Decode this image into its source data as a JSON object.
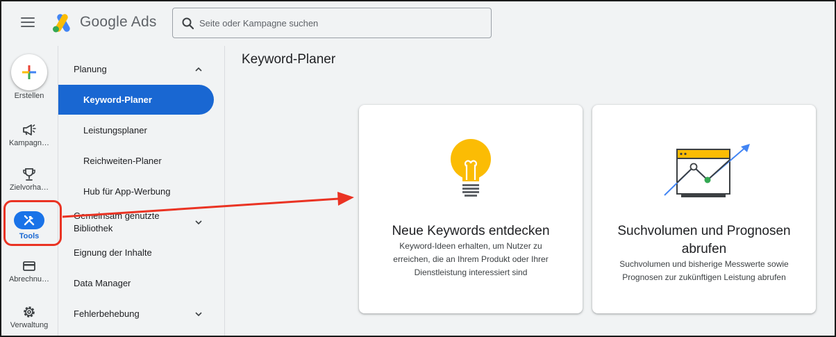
{
  "header": {
    "app_name": "Google Ads",
    "search_placeholder": "Seite oder Kampagne suchen"
  },
  "rail": {
    "items": [
      {
        "label": "Erstellen",
        "icon": "plus-icon"
      },
      {
        "label": "Kampagn…",
        "icon": "megaphone-icon"
      },
      {
        "label": "Zielvorha…",
        "icon": "trophy-icon"
      },
      {
        "label": "Tools",
        "icon": "tools-icon",
        "active": true
      },
      {
        "label": "Abrechnu…",
        "icon": "credit-card-icon"
      },
      {
        "label": "Verwaltung",
        "icon": "gear-icon"
      }
    ]
  },
  "nav": {
    "sections": [
      {
        "label": "Planung",
        "expanded": true
      },
      {
        "label": "Gemeinsam genutzte Bibliothek",
        "expanded": false
      },
      {
        "label": "Eignung der Inhalte"
      },
      {
        "label": "Data Manager"
      },
      {
        "label": "Fehlerbehebung",
        "expanded": false
      }
    ],
    "planning_items": [
      {
        "label": "Keyword-Planer",
        "active": true
      },
      {
        "label": "Leistungsplaner"
      },
      {
        "label": "Reichweiten-Planer"
      },
      {
        "label": "Hub für App-Werbung"
      }
    ]
  },
  "main": {
    "title": "Keyword-Planer",
    "cards": [
      {
        "title": "Neue Keywords entdecken",
        "desc_lines": [
          "Keyword-Ideen erhalten, um Nutzer zu",
          "erreichen, die an Ihrem Produkt oder Ihrer",
          "Dienstleistung interessiert sind"
        ],
        "icon": "lightbulb-icon"
      },
      {
        "title_lines": [
          "Suchvolumen und Prognosen",
          "abrufen"
        ],
        "desc_lines": [
          "Suchvolumen und bisherige Messwerte sowie",
          "Prognosen zur zukünftigen Leistung abrufen"
        ],
        "icon": "trend-chart-icon"
      }
    ]
  },
  "colors": {
    "accent": "#1967d2",
    "annotation": "#ea3323",
    "bulb": "#fbbc04"
  }
}
